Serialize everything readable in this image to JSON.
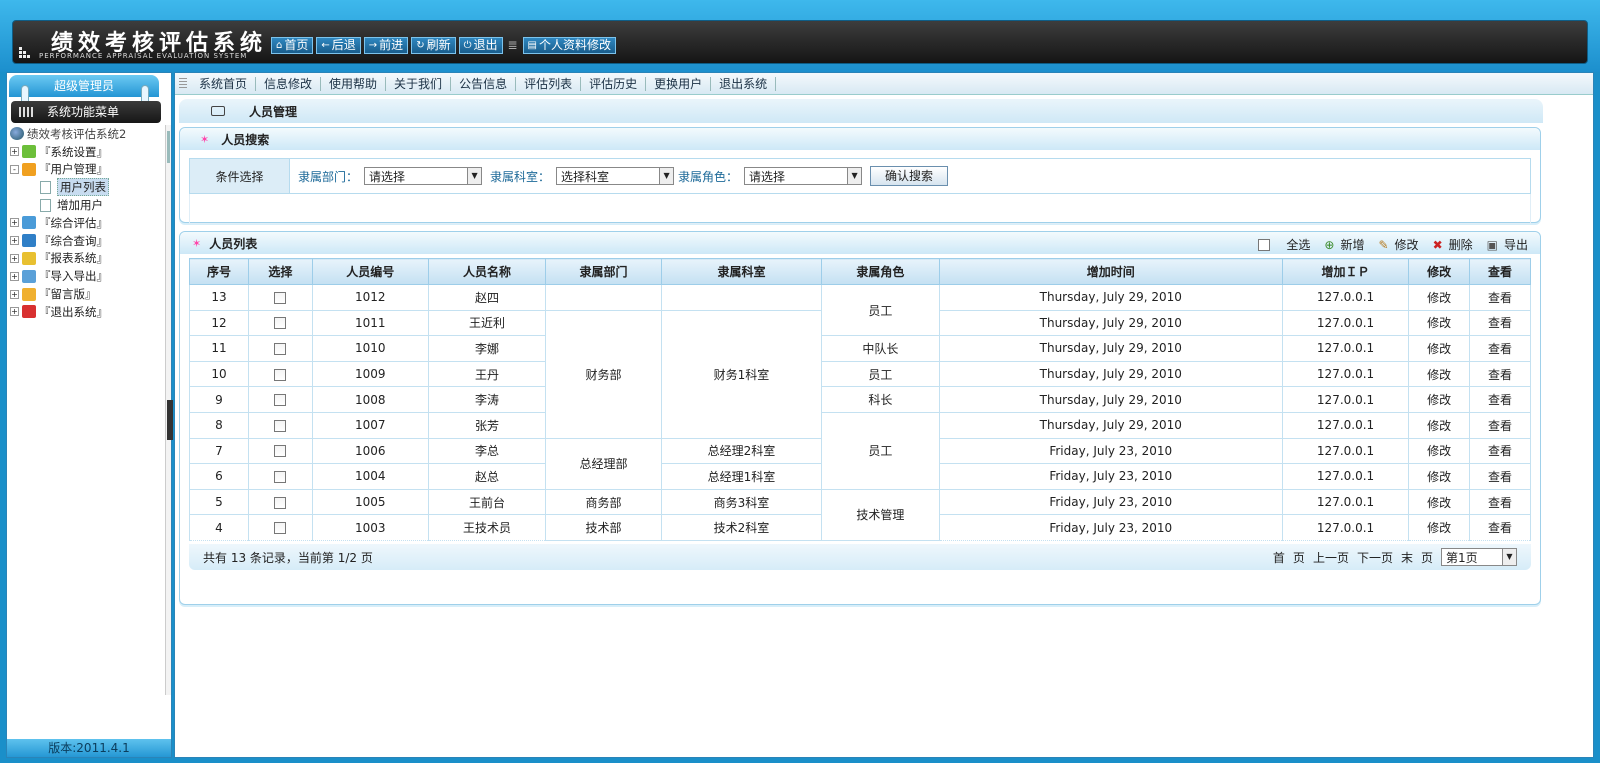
{
  "header": {
    "title": "绩效考核评估系统",
    "subtitle": "PERFORMANCE APPRAISAL EVALUATION SYSTEM",
    "nav": [
      {
        "label": "首页",
        "icon": "home-icon",
        "glyph": "⌂"
      },
      {
        "label": "后退",
        "icon": "back-arrow-icon",
        "glyph": "←"
      },
      {
        "label": "前进",
        "icon": "forward-arrow-icon",
        "glyph": "→"
      },
      {
        "label": "刷新",
        "icon": "refresh-icon",
        "glyph": "↻"
      },
      {
        "label": "退出",
        "icon": "power-icon",
        "glyph": "⏻"
      }
    ],
    "profile_button": "个人资料修改"
  },
  "sidebar": {
    "role": "超级管理员",
    "menu_title": "系统功能菜单",
    "root": "绩效考核评估系统2",
    "items": [
      {
        "label": "『系统设置』",
        "icon": "settings-icon",
        "color": "#6cbf3a",
        "exp": "+"
      },
      {
        "label": "『用户管理』",
        "icon": "user-icon",
        "color": "#f0a020",
        "exp": "-"
      },
      {
        "label": "用户列表",
        "child": true,
        "selected": true
      },
      {
        "label": "增加用户",
        "child": true
      },
      {
        "label": "『综合评估』",
        "icon": "evaluate-icon",
        "color": "#4a9bd8",
        "exp": "+"
      },
      {
        "label": "『综合查询』",
        "icon": "magnifier-icon",
        "color": "#2f7fc7",
        "exp": "+"
      },
      {
        "label": "『报表系统』",
        "icon": "chart-icon",
        "color": "#e8c030",
        "exp": "+"
      },
      {
        "label": "『导入导出』",
        "icon": "import-export-icon",
        "color": "#5aa0d8",
        "exp": "+"
      },
      {
        "label": "『留言版』",
        "icon": "message-icon",
        "color": "#f0b030",
        "exp": "+"
      },
      {
        "label": "『退出系统』",
        "icon": "exit-x-icon",
        "color": "#d83030",
        "exp": "+"
      }
    ],
    "version": "版本:2011.4.1"
  },
  "menubar": [
    "系统首页",
    "信息修改",
    "使用帮助",
    "关于我们",
    "公告信息",
    "评估列表",
    "评估历史",
    "更换用户",
    "退出系统"
  ],
  "page_title": "人员管理",
  "search": {
    "title": "人员搜索",
    "condition_label": "条件选择",
    "dept_label": "隶属部门：",
    "dept_value": "请选择",
    "office_label": "隶属科室：",
    "office_value": "选择科室",
    "role_label": "隶属角色：",
    "role_value": "请选择",
    "button": "确认搜索"
  },
  "list": {
    "title": "人员列表",
    "toolbar": {
      "select_all": "全选",
      "add": "新增",
      "edit": "修改",
      "delete": "删除",
      "export": "导出"
    },
    "columns": [
      "序号",
      "选择",
      "人员编号",
      "人员名称",
      "隶属部门",
      "隶属科室",
      "隶属角色",
      "增加时间",
      "增加ＩＰ",
      "修改",
      "查看"
    ],
    "rows": [
      {
        "no": "13",
        "id": "1012",
        "name": "赵四",
        "time": "Thursday, July 29, 2010",
        "ip": "127.0.0.1"
      },
      {
        "no": "12",
        "id": "1011",
        "name": "王近利",
        "time": "Thursday, July 29, 2010",
        "ip": "127.0.0.1"
      },
      {
        "no": "11",
        "id": "1010",
        "name": "李娜",
        "time": "Thursday, July 29, 2010",
        "ip": "127.0.0.1"
      },
      {
        "no": "10",
        "id": "1009",
        "name": "王丹",
        "time": "Thursday, July 29, 2010",
        "ip": "127.0.0.1"
      },
      {
        "no": "9",
        "id": "1008",
        "name": "李涛",
        "time": "Thursday, July 29, 2010",
        "ip": "127.0.0.1"
      },
      {
        "no": "8",
        "id": "1007",
        "name": "张芳",
        "time": "Thursday, July 29, 2010",
        "ip": "127.0.0.1"
      },
      {
        "no": "7",
        "id": "1006",
        "name": "李总",
        "time": "Friday, July 23, 2010",
        "ip": "127.0.0.1"
      },
      {
        "no": "6",
        "id": "1004",
        "name": "赵总",
        "time": "Friday, July 23, 2010",
        "ip": "127.0.0.1"
      },
      {
        "no": "5",
        "id": "1005",
        "name": "王前台",
        "time": "Friday, July 23, 2010",
        "ip": "127.0.0.1"
      },
      {
        "no": "4",
        "id": "1003",
        "name": "王技术员",
        "time": "Friday, July 23, 2010",
        "ip": "127.0.0.1"
      }
    ],
    "merged": {
      "dept": [
        {
          "label": "",
          "span": 1
        },
        {
          "label": "财务部",
          "span": 5
        },
        {
          "label": "总经理部",
          "span": 2
        },
        {
          "label": "商务部",
          "span": 1
        },
        {
          "label": "技术部",
          "span": 1
        }
      ],
      "office": [
        {
          "label": "",
          "span": 1
        },
        {
          "label": "财务1科室",
          "span": 5
        },
        {
          "label": "总经理2科室",
          "span": 1
        },
        {
          "label": "总经理1科室",
          "span": 1
        },
        {
          "label": "商务3科室",
          "span": 1
        },
        {
          "label": "技术2科室",
          "span": 1
        }
      ],
      "role": [
        {
          "label": "员工",
          "span": 2
        },
        {
          "label": "中队长",
          "span": 1
        },
        {
          "label": "员工",
          "span": 1
        },
        {
          "label": "科长",
          "span": 1
        },
        {
          "label": "员工",
          "span": 3
        },
        {
          "label": "技术管理",
          "span": 2
        }
      ]
    },
    "edit_label": "修改",
    "view_label": "查看",
    "footer": "共有 13 条记录，当前第 1/2 页",
    "pager": {
      "first": "首",
      "prev_word": "页",
      "prev": "上一页",
      "next": "下一页",
      "last": "末",
      "last_word": "页",
      "page_select": "第1页"
    }
  }
}
